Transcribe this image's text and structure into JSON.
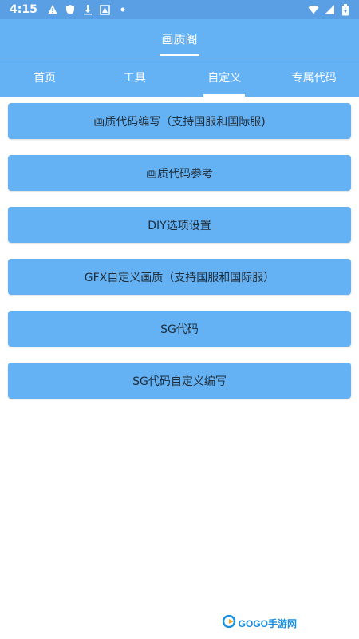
{
  "status_bar": {
    "time": "4:15",
    "icons": [
      "alert-icon",
      "shield-icon",
      "download-icon",
      "app-icon",
      "dot-icon"
    ],
    "right_icons": [
      "wifi-icon",
      "signal-icon",
      "battery-icon"
    ]
  },
  "header": {
    "title": "画质阁"
  },
  "tabs": [
    {
      "label": "首页",
      "active": false
    },
    {
      "label": "工具",
      "active": false
    },
    {
      "label": "自定义",
      "active": true
    },
    {
      "label": "专属代码",
      "active": false
    }
  ],
  "buttons": [
    {
      "label": "画质代码编写（支持国服和国际服)"
    },
    {
      "label": "画质代码参考"
    },
    {
      "label": "DIY选项设置"
    },
    {
      "label": "GFX自定义画质（支持国服和国际服）"
    },
    {
      "label": "SG代码"
    },
    {
      "label": "SG代码自定义编写"
    }
  ],
  "watermark": {
    "text": "GOGO手游网"
  },
  "colors": {
    "status_bar": "#5a9fe3",
    "primary": "#64b1f3",
    "button_text": "#1f2d3a"
  }
}
